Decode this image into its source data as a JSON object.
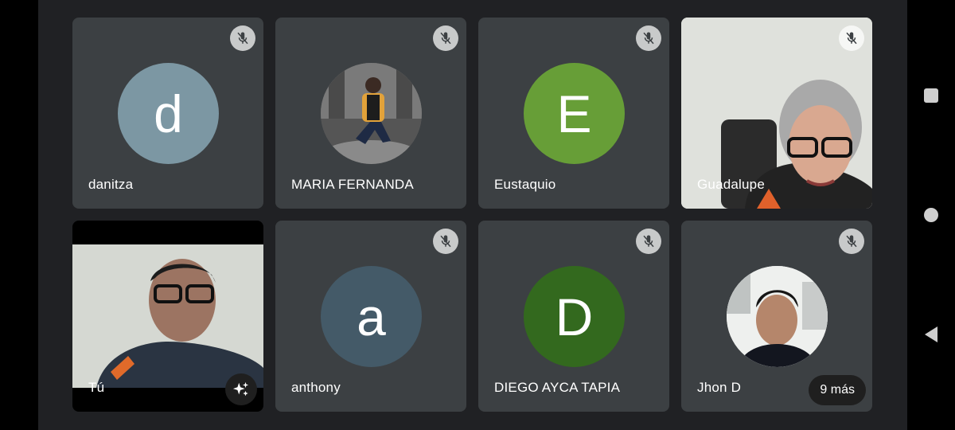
{
  "participants": [
    {
      "name": "danitza",
      "initial": "d",
      "color": "#7c97a3",
      "muted": true
    },
    {
      "name": "MARIA FERNANDA",
      "initial": "",
      "muted": true
    },
    {
      "name": "Eustaquio",
      "initial": "E",
      "color": "#679e37",
      "muted": true
    },
    {
      "name": "Guadalupe",
      "muted": true
    },
    {
      "name": "Tú",
      "muted": false
    },
    {
      "name": "anthony",
      "initial": "a",
      "color": "#445a68",
      "muted": true
    },
    {
      "name": "DIEGO AYCA TAPIA",
      "initial": "D",
      "color": "#33691e",
      "muted": true
    },
    {
      "name": "Jhon D",
      "initial": "",
      "muted": true
    }
  ],
  "more_participants_label": "9 más",
  "icons": {
    "mute": "mic-off-icon",
    "effects": "sparkle-icon",
    "nav": [
      "recents-icon",
      "home-icon",
      "back-icon"
    ]
  }
}
